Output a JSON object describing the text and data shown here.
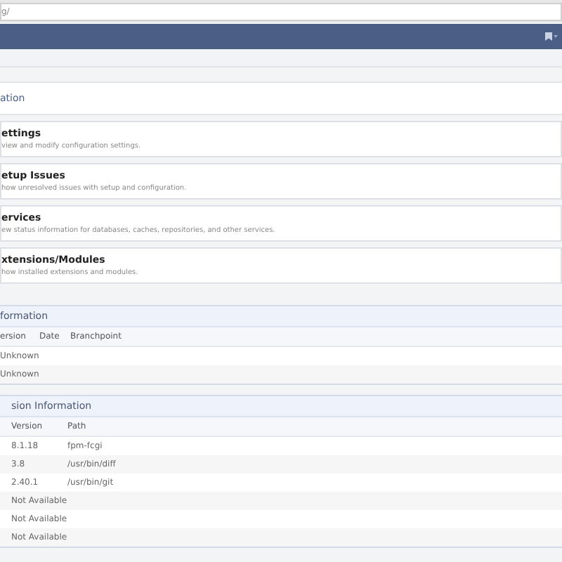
{
  "address_bar": {
    "url": "g/"
  },
  "section_title": "ation",
  "cards": [
    {
      "title": "ettings",
      "description": "view and modify configuration settings."
    },
    {
      "title": "etup Issues",
      "description": "how unresolved issues with setup and configuration."
    },
    {
      "title": "ervices",
      "description": "ew status information for databases, caches, repositories, and other services."
    },
    {
      "title": "xtensions/Modules",
      "description": "how installed extensions and modules."
    }
  ],
  "version_panel": {
    "title": "formation",
    "columns": [
      "ersion",
      "Date",
      "Branchpoint"
    ],
    "rows": [
      [
        "Unknown"
      ],
      [
        "Unknown"
      ]
    ]
  },
  "binary_panel": {
    "title": "sion Information",
    "columns": [
      "Version",
      "Path"
    ],
    "rows": [
      [
        "8.1.18",
        "fpm-fcgi"
      ],
      [
        "3.8",
        "/usr/bin/diff"
      ],
      [
        "2.40.1",
        "/usr/bin/git"
      ],
      [
        "Not Available"
      ],
      [
        "Not Available"
      ],
      [
        "Not Available"
      ]
    ]
  }
}
